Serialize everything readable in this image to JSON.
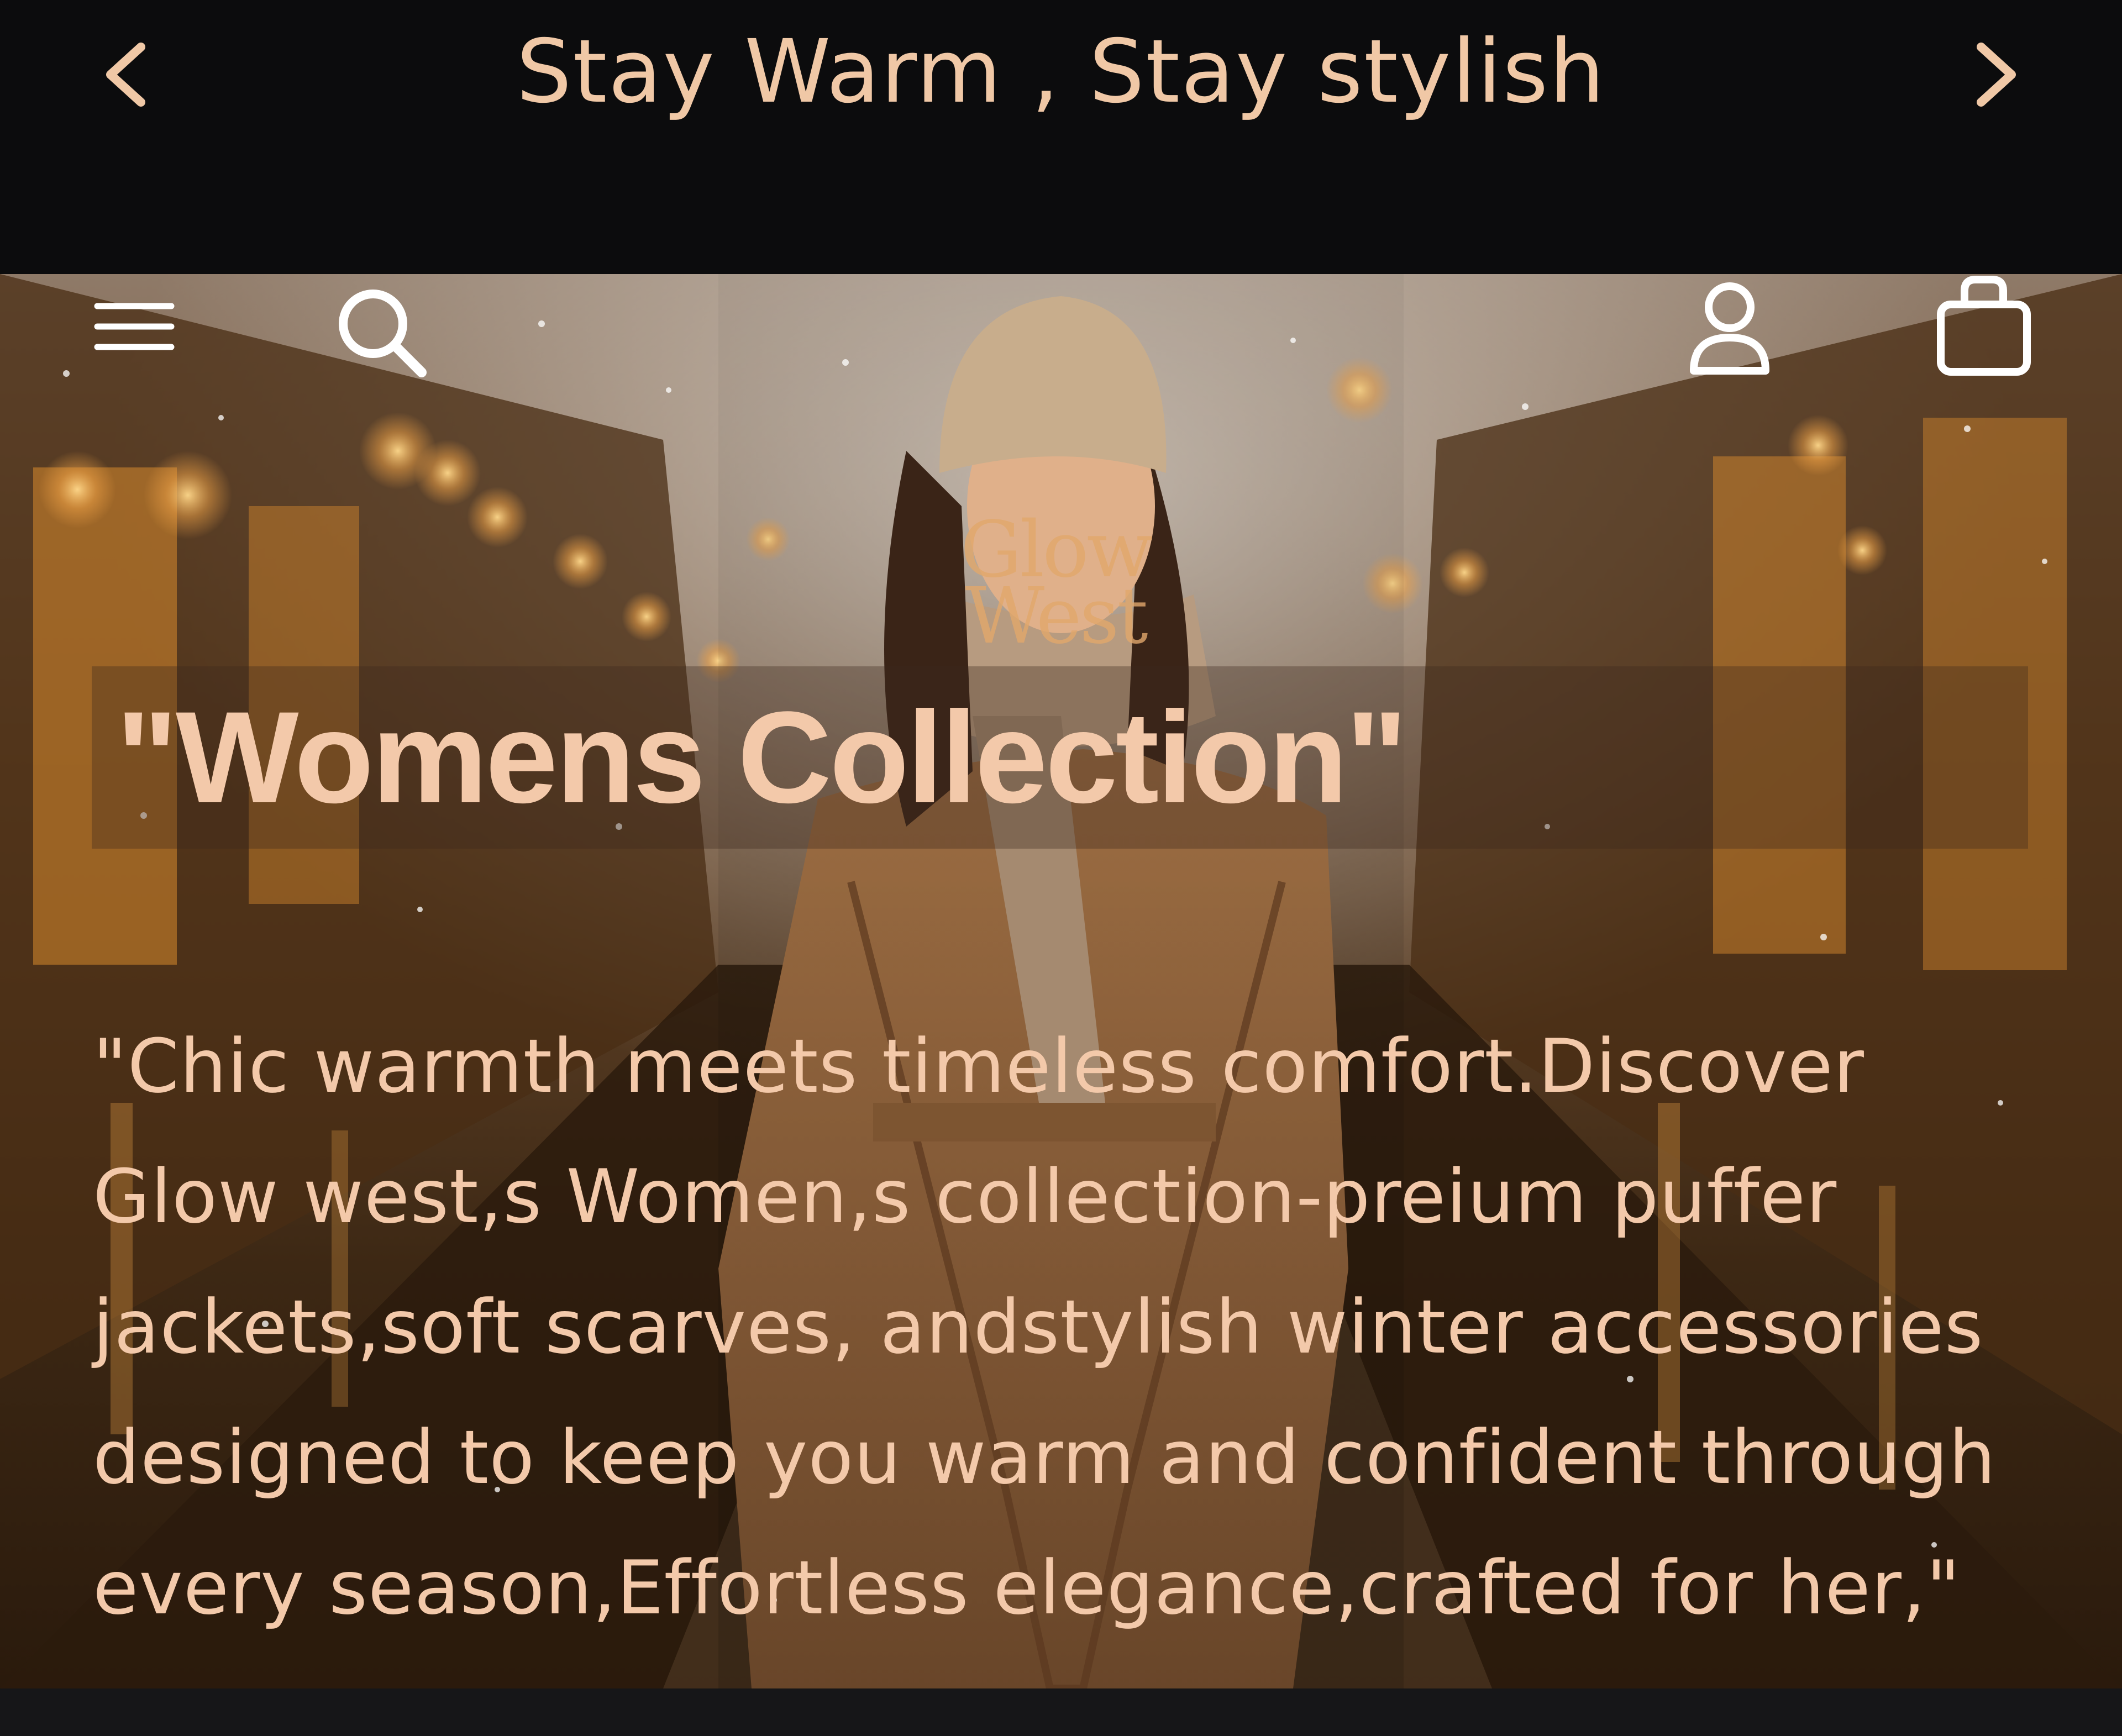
{
  "announcement": {
    "text": "Stay Warm , Stay stylish",
    "prev_icon": "chevron-left-icon",
    "next_icon": "chevron-right-icon"
  },
  "header": {
    "menu_icon": "menu-icon",
    "search_icon": "search-icon",
    "logo": "Glow West",
    "account_icon": "user-icon",
    "cart_icon": "shopping-bag-icon"
  },
  "hero": {
    "title": "\"Womens Collection\"",
    "description": "\"Chic warmth meets timeless comfort.Discover Glow west,s Women,s collection-preium puffer jackets,soft scarves, andstylish winter accessories designed to keep you warm and confident through every season,Effortless elegance,crafted for her,\""
  },
  "colors": {
    "announcement_bg": "#0c0c0d",
    "accent_text": "#f0c8a6",
    "logo": "#e2a86c"
  }
}
